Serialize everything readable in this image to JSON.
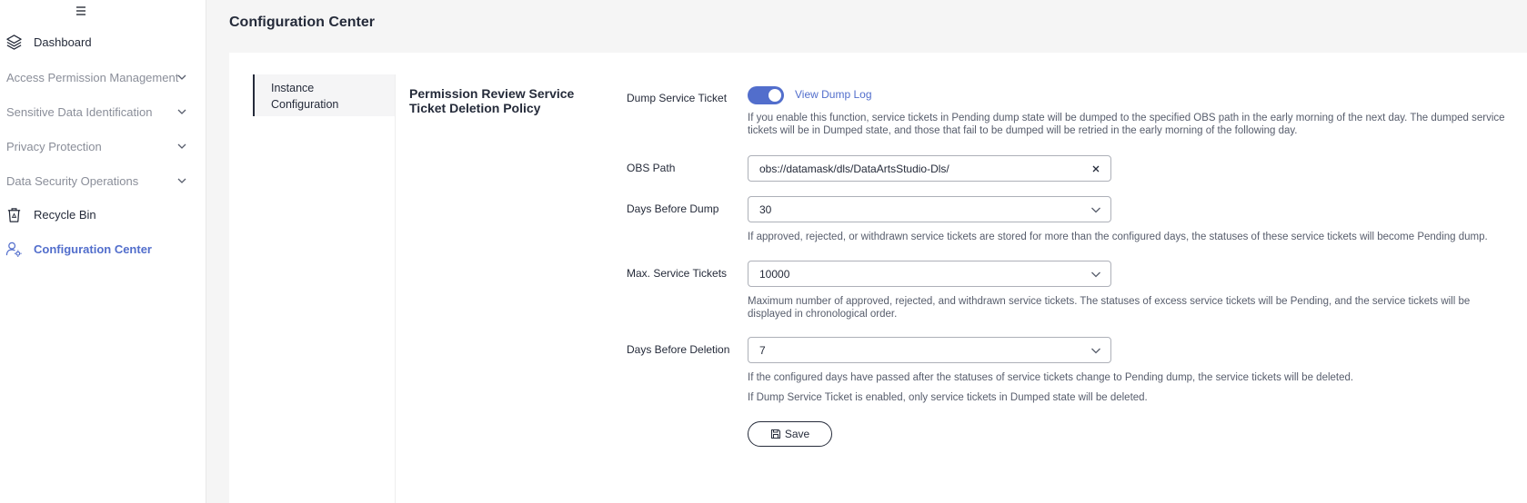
{
  "sidebar": {
    "items": [
      {
        "label": "Dashboard",
        "icon": "layers-icon"
      },
      {
        "label": "Access Permission Management",
        "icon": "chevron-down-icon"
      },
      {
        "label": "Sensitive Data Identification",
        "icon": "chevron-down-icon"
      },
      {
        "label": "Privacy Protection",
        "icon": "chevron-down-icon"
      },
      {
        "label": "Data Security Operations",
        "icon": "chevron-down-icon"
      },
      {
        "label": "Recycle Bin",
        "icon": "recycle-bin-icon"
      },
      {
        "label": "Configuration Center",
        "icon": "config-center-icon",
        "active": true
      }
    ]
  },
  "page": {
    "title": "Configuration Center"
  },
  "sub_nav": {
    "item": "Instance Configuration"
  },
  "section": {
    "title": "Permission Review Service Ticket Deletion Policy"
  },
  "form": {
    "dump_ticket": {
      "label": "Dump Service Ticket",
      "enabled": true,
      "link": "View Dump Log",
      "help": "If you enable this function, service tickets in Pending dump state will be dumped to the specified OBS path in the early morning of the next day. The dumped service tickets will be in Dumped state, and those that fail to be dumped will be retried in the early morning of the following day."
    },
    "obs_path": {
      "label": "OBS Path",
      "value": "obs://datamask/dls/DataArtsStudio-Dls/"
    },
    "days_before_dump": {
      "label": "Days Before Dump",
      "value": "30",
      "help": "If approved, rejected, or withdrawn service tickets are stored for more than the configured days, the statuses of these service tickets will become Pending dump."
    },
    "max_tickets": {
      "label": "Max. Service Tickets",
      "value": "10000",
      "help": "Maximum number of approved, rejected, and withdrawn service tickets. The statuses of excess service tickets will be Pending, and the service tickets will be displayed in chronological order."
    },
    "days_before_deletion": {
      "label": "Days Before Deletion",
      "value": "7",
      "help1": "If the configured days have passed after the statuses of service tickets change to Pending dump, the service tickets will be deleted.",
      "help2": "If Dump Service Ticket is enabled, only service tickets in Dumped state will be deleted."
    },
    "save_label": "Save"
  },
  "colors": {
    "accent": "#526ecc",
    "text": "#252b3a",
    "muted": "#8a8e99"
  }
}
